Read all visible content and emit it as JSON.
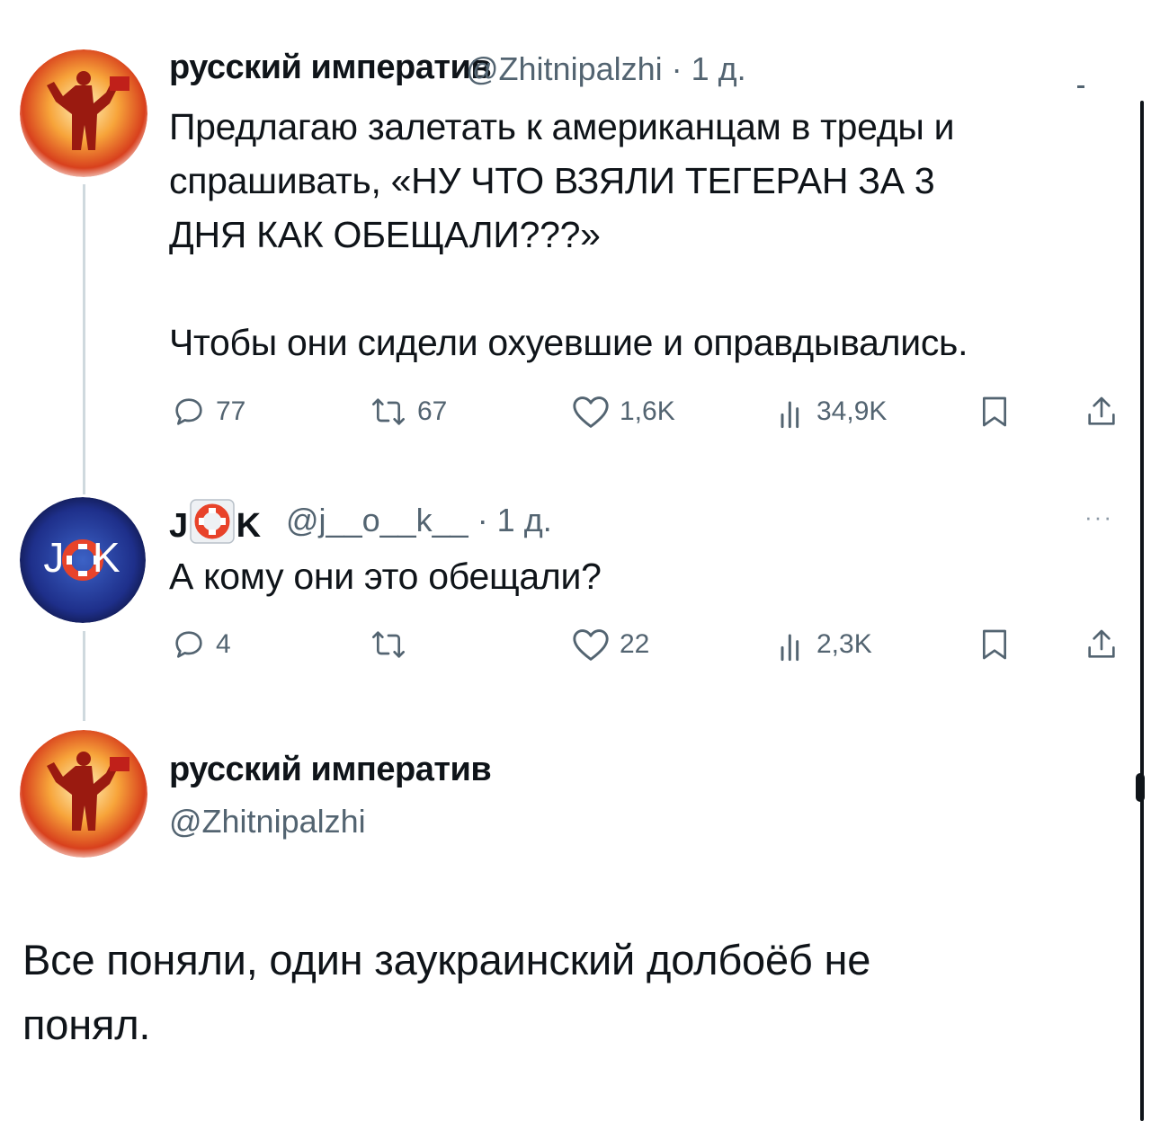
{
  "tweet1": {
    "display_name": "русский императив",
    "handle_time": "@Zhitnipalzhi · 1 д.",
    "text_lines": [
      "Предлагаю залетать к американцам в треды и",
      "спрашивать, «НУ ЧТО ВЗЯЛИ ТЕГЕРАН ЗА 3",
      "ДНЯ КАК ОБЕЩАЛИ???»",
      "Чтобы они сидели охуевшие и оправдывались."
    ],
    "actions": {
      "replies": "77",
      "reposts": "67",
      "likes": "1,6K",
      "views": "34,9K"
    }
  },
  "tweet2": {
    "display_name_left": "J",
    "display_name_right": "K",
    "handle_time": "@j__o__k__ · 1 д.",
    "avatar_text": "J  K",
    "more": "···",
    "text": "А кому они это обещали?",
    "actions": {
      "replies": "4",
      "reposts": "",
      "likes": "22",
      "views": "2,3K"
    }
  },
  "tweet3": {
    "display_name": "русский императив",
    "handle": "@Zhitnipalzhi",
    "text_lines": [
      "Все поняли, один заукраинский долбоёб не",
      "понял."
    ]
  },
  "icons": {
    "reply": "reply-icon",
    "repost": "repost-icon",
    "like": "heart-icon",
    "views": "views-icon",
    "bookmark": "bookmark-icon",
    "share": "share-icon"
  },
  "colors": {
    "text": "#0f1419",
    "secondary": "#536471",
    "thread_line": "#cfd9de"
  }
}
